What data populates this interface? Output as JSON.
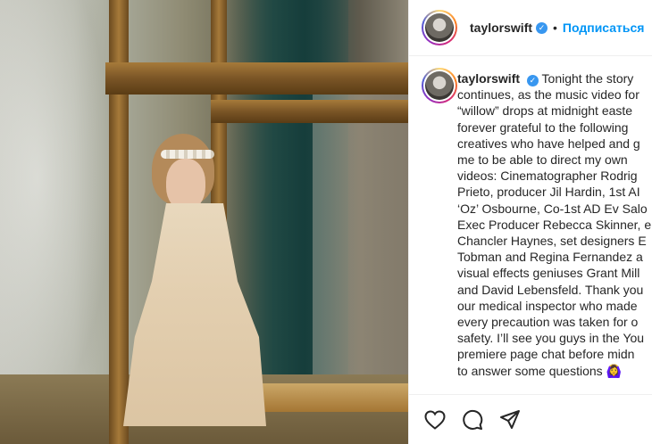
{
  "post": {
    "username": "taylorswift",
    "verified_symbol": "✓",
    "dot": "•",
    "follow_label": "Подписаться",
    "caption_lines": [
      "Tonight the story",
      "continues, as the music video for",
      "“willow” drops at midnight easte",
      "forever grateful to the following",
      "creatives who have helped and g",
      "me to be able to direct my own",
      "videos: Cinematographer Rodrig",
      "Prieto, producer Jil Hardin, 1st AI",
      "‘Oz’ Osbourne, Co-1st AD Ev Salo",
      "Exec Producer Rebecca Skinner, e",
      "Chancler Haynes, set designers E",
      "Tobman and Regina Fernandez a",
      "visual effects geniuses Grant Mill",
      "and David Lebensfeld. Thank you",
      "our medical inspector who made",
      "every precaution was taken for o",
      "safety. I’ll see you guys in the You",
      "premiere page chat before midn",
      "to answer some questions 🙆‍♀️"
    ]
  },
  "icons": {
    "like": "heart-icon",
    "comment": "comment-icon",
    "share": "share-icon"
  },
  "colors": {
    "link": "#0095f6",
    "verified": "#3897f0",
    "text": "#262626",
    "border": "#efefef"
  }
}
